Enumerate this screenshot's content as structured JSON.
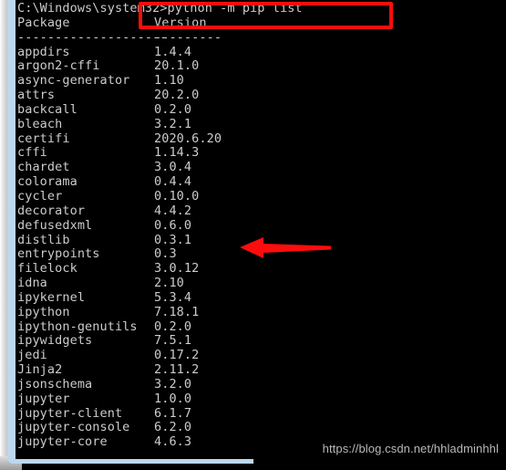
{
  "terminal": {
    "prompt_line": "C:\\Windows\\system32>python -m pip list",
    "header": {
      "package_col": "Package",
      "version_col": "Version"
    },
    "separator": {
      "package_rule": "--------------------",
      "version_rule": "---------"
    },
    "packages": [
      {
        "name": "appdirs",
        "version": "1.4.4"
      },
      {
        "name": "argon2-cffi",
        "version": "20.1.0"
      },
      {
        "name": "async-generator",
        "version": "1.10"
      },
      {
        "name": "attrs",
        "version": "20.2.0"
      },
      {
        "name": "backcall",
        "version": "0.2.0"
      },
      {
        "name": "bleach",
        "version": "3.2.1"
      },
      {
        "name": "certifi",
        "version": "2020.6.20"
      },
      {
        "name": "cffi",
        "version": "1.14.3"
      },
      {
        "name": "chardet",
        "version": "3.0.4"
      },
      {
        "name": "colorama",
        "version": "0.4.4"
      },
      {
        "name": "cycler",
        "version": "0.10.0"
      },
      {
        "name": "decorator",
        "version": "4.4.2"
      },
      {
        "name": "defusedxml",
        "version": "0.6.0"
      },
      {
        "name": "distlib",
        "version": "0.3.1"
      },
      {
        "name": "entrypoints",
        "version": "0.3"
      },
      {
        "name": "filelock",
        "version": "3.0.12"
      },
      {
        "name": "idna",
        "version": "2.10"
      },
      {
        "name": "ipykernel",
        "version": "5.3.4"
      },
      {
        "name": "ipython",
        "version": "7.18.1"
      },
      {
        "name": "ipython-genutils",
        "version": "0.2.0"
      },
      {
        "name": "ipywidgets",
        "version": "7.5.1"
      },
      {
        "name": "jedi",
        "version": "0.17.2"
      },
      {
        "name": "Jinja2",
        "version": "2.11.2"
      },
      {
        "name": "jsonschema",
        "version": "3.2.0"
      },
      {
        "name": "jupyter",
        "version": "1.0.0"
      },
      {
        "name": "jupyter-client",
        "version": "6.1.7"
      },
      {
        "name": "jupyter-console",
        "version": "6.2.0"
      },
      {
        "name": "jupyter-core",
        "version": "4.6.3"
      }
    ]
  },
  "annotations": {
    "highlight_rect_color": "#fc0d0d",
    "arrow_color": "#fc0d0d",
    "arrow_target": "distlib"
  },
  "watermark": {
    "text": "https://blog.csdn.net/hhladminhhl"
  },
  "colors": {
    "console_bg": "#000000",
    "console_fg": "#cccccc",
    "window_frame": "#bcd7ef"
  }
}
